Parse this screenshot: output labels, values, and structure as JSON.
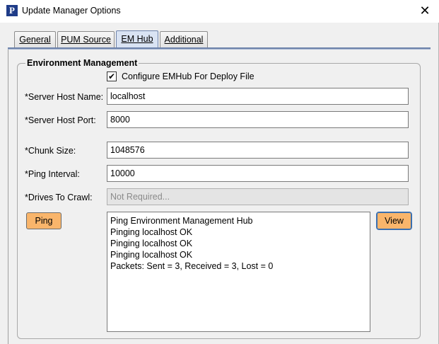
{
  "window": {
    "title": "Update Manager Options",
    "icon_letter": "P"
  },
  "tabs": [
    {
      "label": "General",
      "active": false
    },
    {
      "label": "PUM Source",
      "active": false
    },
    {
      "label": "EM Hub",
      "active": true
    },
    {
      "label": "Additional",
      "active": false
    }
  ],
  "group": {
    "title": "Environment Management"
  },
  "checkbox": {
    "label": "Configure EMHub For Deploy File",
    "checked": true,
    "mark": "✔"
  },
  "fields": {
    "server_host_name": {
      "label": "*Server Host Name:",
      "value": "localhost"
    },
    "server_host_port": {
      "label": "*Server Host Port:",
      "value": "8000"
    },
    "chunk_size": {
      "label": "*Chunk Size:",
      "value": "1048576"
    },
    "ping_interval": {
      "label": "*Ping Interval:",
      "value": "10000"
    },
    "drives_to_crawl": {
      "label": "*Drives To Crawl:",
      "placeholder": "Not Required..."
    }
  },
  "buttons": {
    "ping": "Ping",
    "view": "View"
  },
  "output_lines": [
    "Ping Environment Management Hub",
    "Pinging localhost OK",
    "Pinging localhost OK",
    "Pinging localhost OK",
    "Packets: Sent = 3, Received = 3, Lost = 0"
  ],
  "colors": {
    "button_accent": "#f9b56b",
    "tab_active": "#d9e3f3",
    "app_icon": "#1f3c88"
  }
}
